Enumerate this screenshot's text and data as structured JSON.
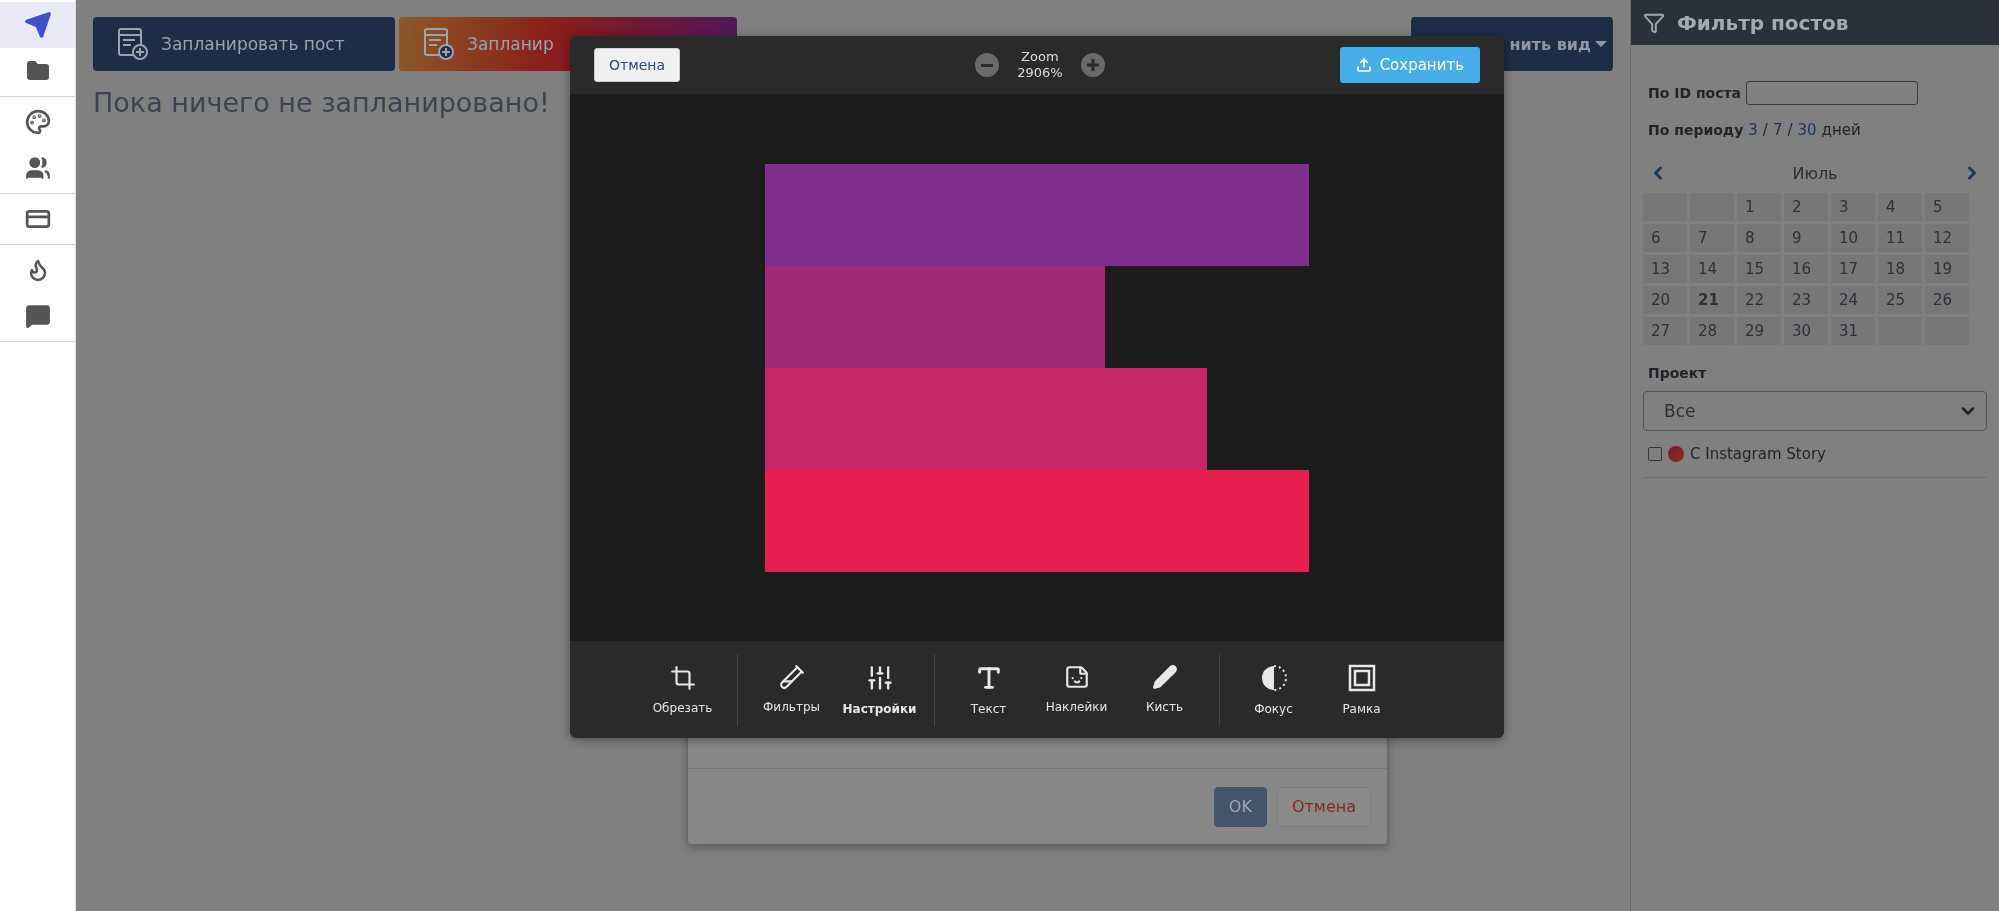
{
  "sidebar": {
    "groups": [
      {
        "items": [
          {
            "selected": true
          },
          {
            "selected": false
          }
        ]
      },
      {
        "items": [
          {
            "selected": false
          },
          {
            "selected": false
          }
        ]
      },
      {
        "items": [
          {
            "selected": false
          }
        ]
      },
      {
        "items": [
          {
            "selected": false
          },
          {
            "selected": false
          }
        ]
      }
    ]
  },
  "toolbar": {
    "buttons": [
      {
        "label": "Запланировать пост",
        "kind": "primary"
      },
      {
        "label": "Запланир",
        "kind": "gradient"
      }
    ],
    "view_button": {
      "label": "нить вид"
    }
  },
  "heading": "Пока ничего не запланировано!",
  "dialog": {
    "buttons": [
      {
        "label": "OK",
        "kind": "primary"
      },
      {
        "label": "Отмена",
        "kind": "cancel"
      }
    ]
  },
  "editor": {
    "cancel": "Отмена",
    "zoom": {
      "label": "Zoom",
      "value": "2906%"
    },
    "save": "Сохранить",
    "tool_groups": [
      {
        "tools": [
          {
            "label": "Обрезать",
            "selected": false
          }
        ]
      },
      {
        "tools": [
          {
            "label": "Фильтры",
            "selected": false
          },
          {
            "label": "Настройки",
            "selected": true
          }
        ]
      },
      {
        "tools": [
          {
            "label": "Текст",
            "selected": false
          },
          {
            "label": "Наклейки",
            "selected": false
          },
          {
            "label": "Кисть",
            "selected": false
          }
        ]
      },
      {
        "tools": [
          {
            "label": "Фокус",
            "selected": false
          },
          {
            "label": "Рамка",
            "selected": false
          }
        ]
      }
    ]
  },
  "filter": {
    "title": "Фильтр постов",
    "post_id": {
      "label": "По ID поста"
    },
    "period": {
      "label": "По периоду",
      "options": [
        "3",
        "7",
        "30"
      ],
      "separator": "/",
      "suffix": "дней"
    },
    "calendar": {
      "month": "Июль",
      "cells": [
        {
          "kind": "empty"
        },
        {
          "kind": "empty"
        },
        {
          "kind": "day",
          "text": "1",
          "today": false
        },
        {
          "kind": "day",
          "text": "2",
          "today": false
        },
        {
          "kind": "day",
          "text": "3",
          "today": false
        },
        {
          "kind": "day",
          "text": "4",
          "today": false
        },
        {
          "kind": "day",
          "text": "5",
          "today": false
        },
        {
          "kind": "day",
          "text": "6",
          "today": false
        },
        {
          "kind": "day",
          "text": "7",
          "today": false
        },
        {
          "kind": "day",
          "text": "8",
          "today": false
        },
        {
          "kind": "day",
          "text": "9",
          "today": false
        },
        {
          "kind": "day",
          "text": "10",
          "today": false
        },
        {
          "kind": "day",
          "text": "11",
          "today": false
        },
        {
          "kind": "day",
          "text": "12",
          "today": false
        },
        {
          "kind": "day",
          "text": "13",
          "today": false
        },
        {
          "kind": "day",
          "text": "14",
          "today": false
        },
        {
          "kind": "day",
          "text": "15",
          "today": false
        },
        {
          "kind": "day",
          "text": "16",
          "today": false
        },
        {
          "kind": "day",
          "text": "17",
          "today": false
        },
        {
          "kind": "day",
          "text": "18",
          "today": false
        },
        {
          "kind": "day",
          "text": "19",
          "today": false
        },
        {
          "kind": "day",
          "text": "20",
          "today": false
        },
        {
          "kind": "day",
          "text": "21",
          "today": true
        },
        {
          "kind": "day",
          "text": "22",
          "today": false
        },
        {
          "kind": "day",
          "text": "23",
          "today": false
        },
        {
          "kind": "day",
          "text": "24",
          "today": false
        },
        {
          "kind": "day",
          "text": "25",
          "today": false
        },
        {
          "kind": "day",
          "text": "26",
          "today": false
        },
        {
          "kind": "day",
          "text": "27",
          "today": false
        },
        {
          "kind": "day",
          "text": "28",
          "today": false
        },
        {
          "kind": "day",
          "text": "29",
          "today": false
        },
        {
          "kind": "day",
          "text": "30",
          "today": false
        },
        {
          "kind": "day",
          "text": "31",
          "today": false
        },
        {
          "kind": "empty"
        },
        {
          "kind": "empty"
        }
      ]
    },
    "project": {
      "label": "Проект",
      "value": "Все"
    },
    "options": [
      {
        "label": "C Instagram Story",
        "checked": false
      }
    ]
  }
}
